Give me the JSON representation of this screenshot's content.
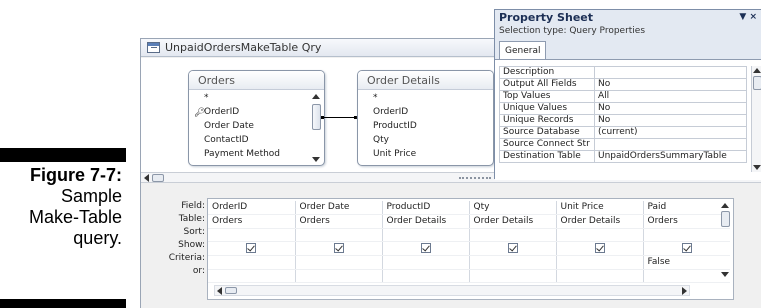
{
  "caption": {
    "figure": "Figure 7-7:",
    "lines": [
      "Sample",
      "Make-Table",
      "query."
    ]
  },
  "query_window": {
    "title": "UnpaidOrdersMakeTable Qry",
    "tables": [
      {
        "name": "Orders",
        "fields": [
          "*",
          "OrderID",
          "Order Date",
          "ContactID",
          "Payment Method"
        ],
        "key_field": "OrderID"
      },
      {
        "name": "Order Details",
        "fields": [
          "*",
          "OrderID",
          "ProductID",
          "Qty",
          "Unit Price"
        ]
      }
    ]
  },
  "design_grid": {
    "row_labels": [
      "Field:",
      "Table:",
      "Sort:",
      "Show:",
      "Criteria:",
      "or:"
    ],
    "columns": [
      {
        "field": "OrderID",
        "table": "Orders",
        "sort": "",
        "show": true,
        "criteria": "",
        "or": ""
      },
      {
        "field": "Order Date",
        "table": "Orders",
        "sort": "",
        "show": true,
        "criteria": "",
        "or": ""
      },
      {
        "field": "ProductID",
        "table": "Order Details",
        "sort": "",
        "show": true,
        "criteria": "",
        "or": ""
      },
      {
        "field": "Qty",
        "table": "Order Details",
        "sort": "",
        "show": true,
        "criteria": "",
        "or": ""
      },
      {
        "field": "Unit Price",
        "table": "Order Details",
        "sort": "",
        "show": true,
        "criteria": "",
        "or": ""
      },
      {
        "field": "Paid",
        "table": "Orders",
        "sort": "",
        "show": true,
        "criteria": "False",
        "or": ""
      }
    ]
  },
  "property_sheet": {
    "title": "Property Sheet",
    "title_buttons": "▼ ×",
    "selection_type": "Selection type:  Query Properties",
    "tab": "General",
    "properties": [
      {
        "name": "Description",
        "value": ""
      },
      {
        "name": "Output All Fields",
        "value": "No"
      },
      {
        "name": "Top Values",
        "value": "All"
      },
      {
        "name": "Unique Values",
        "value": "No"
      },
      {
        "name": "Unique Records",
        "value": "No"
      },
      {
        "name": "Source Database",
        "value": "(current)"
      },
      {
        "name": "Source Connect Str",
        "value": ""
      },
      {
        "name": "Destination Table",
        "value": "UnpaidOrdersSummaryTable"
      }
    ]
  }
}
